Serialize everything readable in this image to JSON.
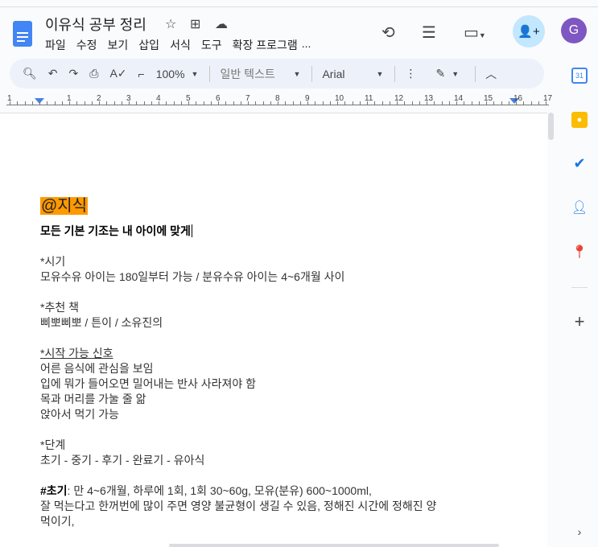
{
  "doc": {
    "title": "이유식 공부 정리"
  },
  "menu": [
    "파일",
    "수정",
    "보기",
    "삽입",
    "서식",
    "도구",
    "확장 프로그램",
    "..."
  ],
  "toolbar": {
    "zoom": "100%",
    "style": "일반 텍스트",
    "font": "Arial"
  },
  "ruler": [
    "1",
    "1",
    "2",
    "3",
    "4",
    "5",
    "6",
    "7",
    "8",
    "9",
    "10",
    "11",
    "12",
    "13",
    "14",
    "15",
    "16",
    "17"
  ],
  "user": {
    "initial": "G"
  },
  "calendar_day": "31",
  "content": {
    "tag": "@지식",
    "heading": "모든 기본 기조는 내 아이에 맞게",
    "l1": "*시기",
    "l2": "모유수유 아이는 180일부터 가능 / 분유수유 아이는 4~6개월 사이",
    "l3": "*추천 책",
    "l4": "삐뽀삐뽀 / 튼이 / 소유진의",
    "l5": "*시작 가능 신호",
    "l6": "어른 음식에 관심을 보임",
    "l7": "입에 뭐가 들어오면 밀어내는 반사 사라져야 함",
    "l8": "목과 머리를 가눌 줄 앎",
    "l9": "앉아서 먹기 가능",
    "l10": "*단계",
    "l11": "초기 - 중기 - 후기 - 완료기 - 유아식",
    "l12_bold": "#초기",
    "l12_rest": ": 만 4~6개월, 하루에 1회, 1회 30~60g, 모유(분유) 600~1000ml,",
    "l13": "잘 먹는다고 한꺼번에 많이 주면 영양 불균형이 생길 수 있음, 정해진 시간에 정해진 양",
    "l14": "먹이기,"
  }
}
